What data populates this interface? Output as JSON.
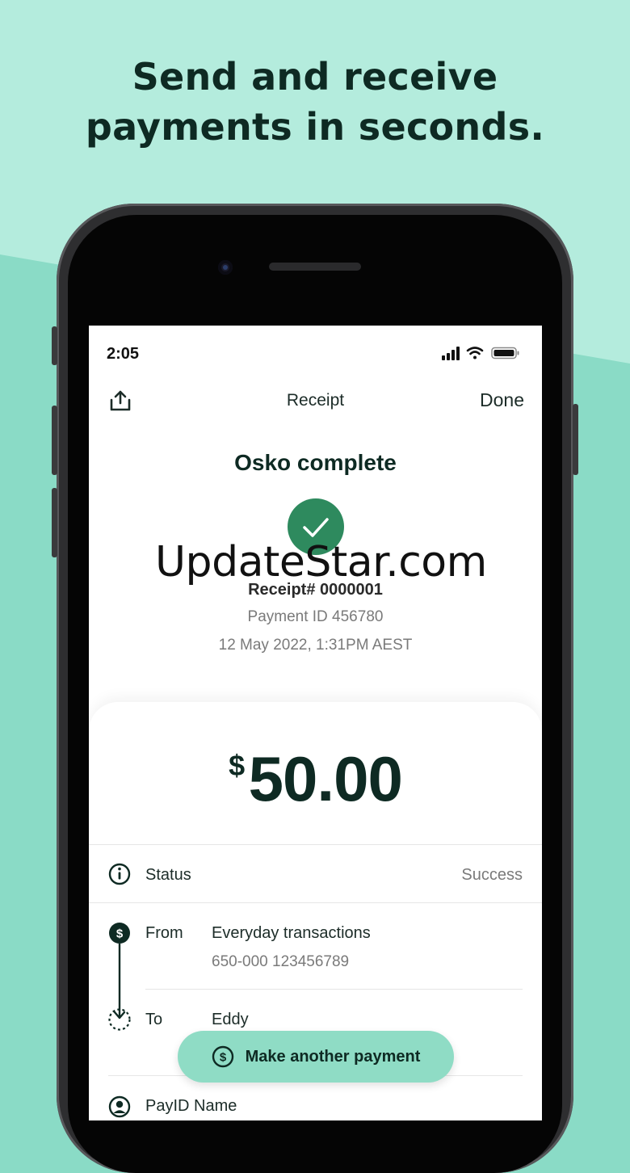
{
  "headline": {
    "line1": "Send and receive",
    "line2": "payments in seconds."
  },
  "status_bar": {
    "time": "2:05",
    "icons": [
      "cellular-signal-icon",
      "wifi-icon",
      "battery-icon"
    ]
  },
  "nav": {
    "title": "Receipt",
    "done_label": "Done",
    "share_icon": "share-icon"
  },
  "receipt": {
    "title": "Osko complete",
    "check_icon": "checkmark-icon",
    "receipt_number": "Receipt# 0000001",
    "payment_id": "Payment ID 456780",
    "date": "12 May 2022, 1:31PM AEST"
  },
  "watermark": "UpdateStar.com",
  "amount": {
    "currency": "$",
    "value": "50.00"
  },
  "details": {
    "status": {
      "label": "Status",
      "value": "Success",
      "icon": "info-icon"
    },
    "from": {
      "label": "From",
      "account_name": "Everyday transactions",
      "account_number": "650-000 123456789",
      "icon": "dollar-icon"
    },
    "to": {
      "label": "To",
      "name": "Eddy",
      "icon": "arrow-down-icon"
    },
    "payid": {
      "label": "PayID Name",
      "icon": "person-icon"
    }
  },
  "fab": {
    "label": "Make another payment",
    "icon": "dollar-circle-icon"
  },
  "colors": {
    "accent": "#2e8a5e",
    "fab": "#8fdcc5",
    "background_top": "#b4ecdd",
    "background_bottom": "#8adbc6",
    "text_dark": "#0e2a23"
  }
}
